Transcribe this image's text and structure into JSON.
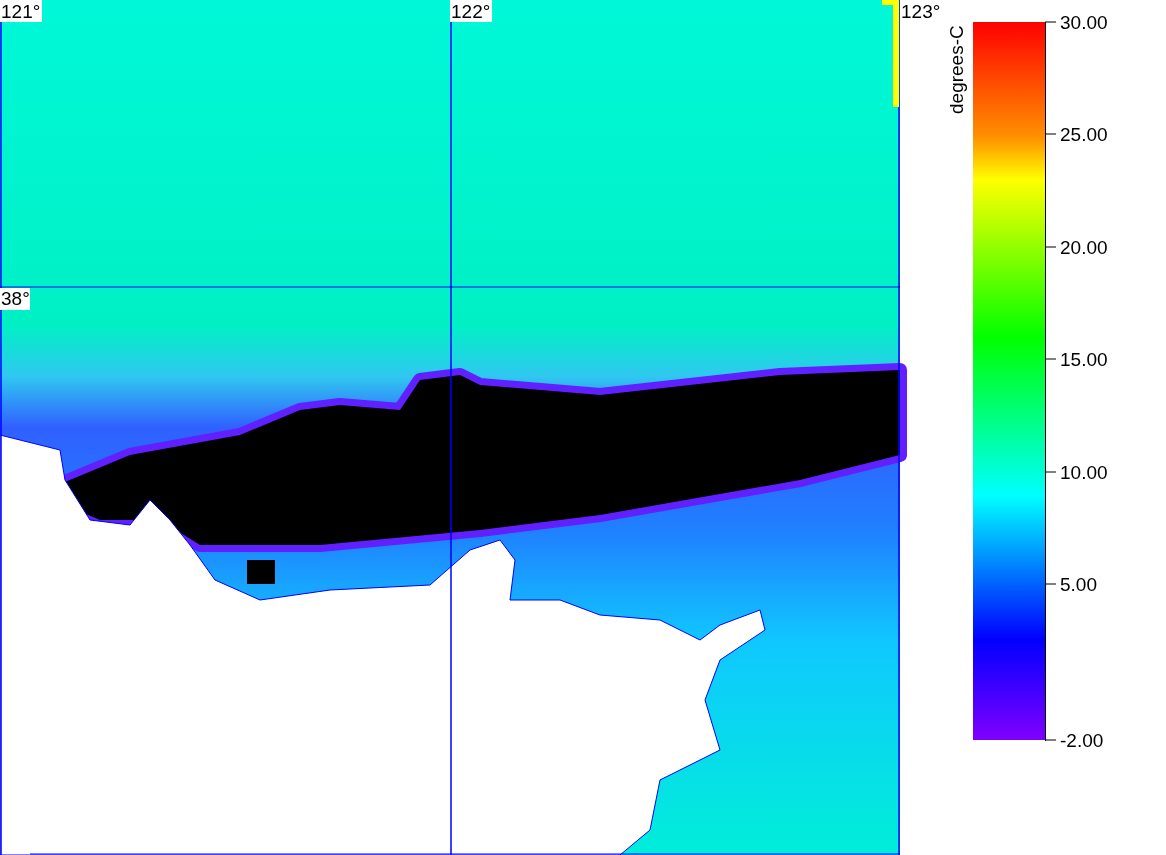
{
  "map": {
    "longitude_labels": [
      "121°",
      "122°",
      "123°"
    ],
    "latitude_labels": [
      "38°"
    ]
  },
  "legend": {
    "unit": "degrees-C",
    "ticks": [
      "30.00",
      "25.00",
      "20.00",
      "15.00",
      "10.00",
      "5.00",
      "-2.00"
    ]
  }
}
